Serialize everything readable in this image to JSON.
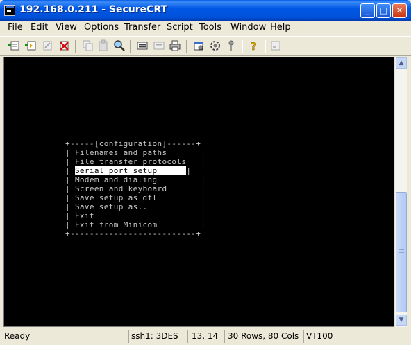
{
  "window": {
    "title": "192.168.0.211 - SecureCRT"
  },
  "title_buttons": {
    "minimize": "_",
    "maximize": "□",
    "close": "✕"
  },
  "menu": [
    "File",
    "Edit",
    "View",
    "Options",
    "Transfer",
    "Script",
    "Tools",
    "Window",
    "Help"
  ],
  "toolbar": {
    "icons": [
      "connect-icon",
      "quick-connect-icon",
      "reconnect-icon",
      "disconnect-icon",
      "copy-icon",
      "paste-icon",
      "find-icon",
      "print-icon",
      "print-selection-icon",
      "printer-icon",
      "session-options-icon",
      "global-options-icon",
      "keymap-icon",
      "help-icon",
      "log-icon"
    ]
  },
  "terminal": {
    "lines": [
      "+-----[configuration]------+",
      "| Filenames and paths       |",
      "| File transfer protocols   |",
      "| Modem and dialing         |",
      "| Screen and keyboard       |",
      "| Save setup as dfl         |",
      "| Save setup as..           |",
      "| Exit                      |",
      "| Exit from Minicom         |",
      "+--------------------------+"
    ],
    "selected_prefix": "| ",
    "selected_item": "Serial port setup      ",
    "selected_suffix": "|",
    "colors": {
      "background": "#000000",
      "text": "#c8c8c8",
      "highlight_bg": "#ffffff"
    }
  },
  "status": {
    "ready": "Ready",
    "encryption": "ssh1: 3DES",
    "cursor": "13,  14",
    "size": "30 Rows,  80 Cols",
    "emulation": "VT100"
  }
}
